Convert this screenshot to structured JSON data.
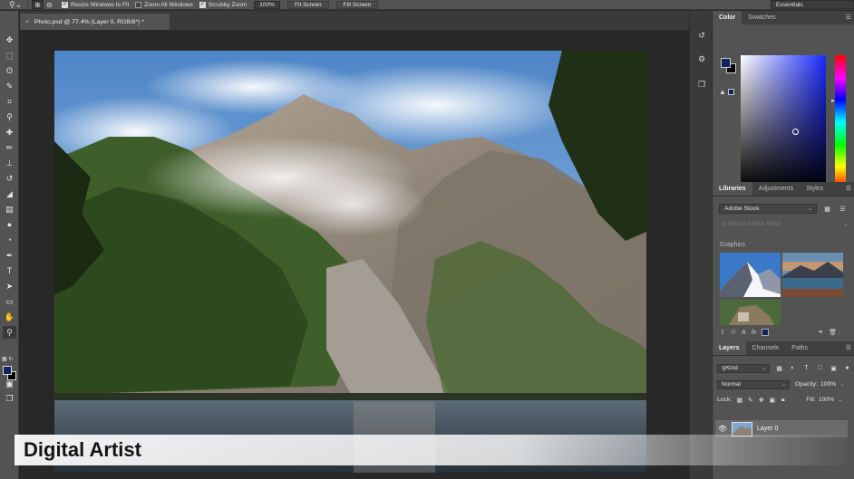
{
  "options_bar": {
    "tool_icon": "zoom-icon",
    "zoom_in_icon": "zoom-in-icon",
    "zoom_out_icon": "zoom-out-icon",
    "resize_windows": {
      "label": "Resize Windows to Fit",
      "checked": true
    },
    "zoom_all_windows": {
      "label": "Zoom All Windows",
      "checked": false
    },
    "scrubby_zoom": {
      "label": "Scrubby Zoom",
      "checked": true
    },
    "zoom_value": "100%",
    "fit_screen_label": "Fit Screen",
    "fill_screen_label": "Fill Screen",
    "workspace": "Essentials"
  },
  "document": {
    "tab_title": "Photo.psd @ 77.4% (Layer 0, RGB/8*) *",
    "close": "×"
  },
  "toolbar": {
    "tools": [
      {
        "name": "move-tool",
        "glyph": "✥"
      },
      {
        "name": "marquee-tool",
        "glyph": "⬚"
      },
      {
        "name": "lasso-tool",
        "glyph": "ʘ"
      },
      {
        "name": "quick-select-tool",
        "glyph": "✎"
      },
      {
        "name": "crop-tool",
        "glyph": "⌗"
      },
      {
        "name": "eyedropper-tool",
        "glyph": "⚲"
      },
      {
        "name": "healing-brush-tool",
        "glyph": "✚"
      },
      {
        "name": "brush-tool",
        "glyph": "✏"
      },
      {
        "name": "clone-stamp-tool",
        "glyph": "⊥"
      },
      {
        "name": "history-brush-tool",
        "glyph": "↺"
      },
      {
        "name": "eraser-tool",
        "glyph": "◢"
      },
      {
        "name": "gradient-tool",
        "glyph": "▤"
      },
      {
        "name": "blur-tool",
        "glyph": "●"
      },
      {
        "name": "dodge-tool",
        "glyph": "◔"
      },
      {
        "name": "pen-tool",
        "glyph": "✒"
      },
      {
        "name": "type-tool",
        "glyph": "T"
      },
      {
        "name": "path-select-tool",
        "glyph": "➤"
      },
      {
        "name": "shape-tool",
        "glyph": "▭"
      },
      {
        "name": "hand-tool",
        "glyph": "✋"
      },
      {
        "name": "zoom-tool",
        "glyph": "🔍︎"
      }
    ],
    "selected": "zoom-tool",
    "foreground_color": "#13215d",
    "background_color": "#000000"
  },
  "panel_rail": {
    "icons": [
      "history-icon",
      "properties-icon",
      "artboard-icon"
    ]
  },
  "color_panel": {
    "tabs": [
      "Color",
      "Swatches"
    ],
    "active_tab": "Color",
    "foreground": "#13215d",
    "background": "#000000"
  },
  "libraries_panel": {
    "tabs": [
      "Libraries",
      "Adjustments",
      "Styles"
    ],
    "active_tab": "Libraries",
    "library": "Adobe Stock",
    "search_placeholder": "Search Adobe Stock",
    "section": "Graphics",
    "thumbnails": [
      "snowy-mountain-thumbnail",
      "lake-sunset-thumbnail",
      "tropical-hut-thumbnail"
    ],
    "swatch_color": "#13215d"
  },
  "layers_panel": {
    "tabs": [
      "Layers",
      "Channels",
      "Paths"
    ],
    "active_tab": "Layers",
    "filter_kind": "Kind",
    "blend_mode": "Normal",
    "opacity_label": "Opacity:",
    "opacity": "100%",
    "lock_label": "Lock:",
    "fill_label": "Fill:",
    "fill": "100%",
    "layers": [
      {
        "name": "Layer 0",
        "visible": true
      }
    ]
  },
  "caption": {
    "text": "Digital Artist"
  }
}
